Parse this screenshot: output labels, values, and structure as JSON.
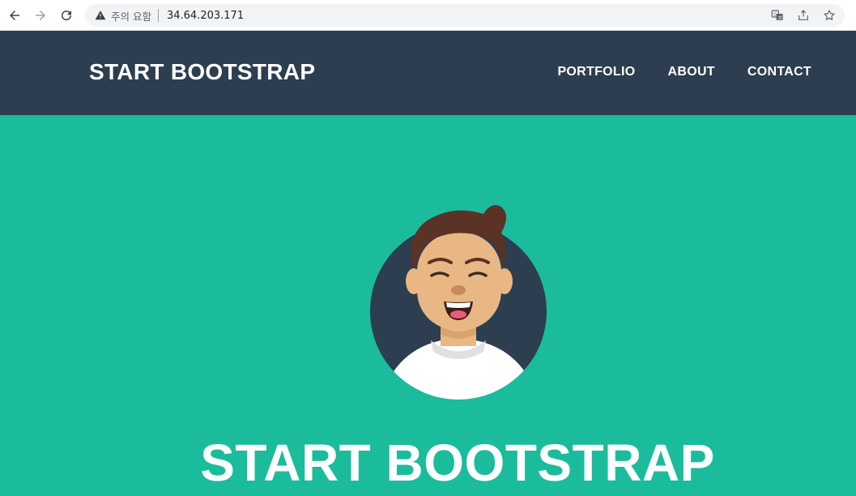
{
  "browser": {
    "security_warning": "주의 요함",
    "url": "34.64.203.171",
    "icons": [
      "back-arrow-icon",
      "forward-arrow-icon",
      "reload-icon",
      "warning-triangle-icon",
      "translate-icon",
      "share-icon",
      "star-icon"
    ]
  },
  "navbar": {
    "brand": "START BOOTSTRAP",
    "items": [
      {
        "label": "PORTFOLIO"
      },
      {
        "label": "ABOUT"
      },
      {
        "label": "CONTACT"
      }
    ]
  },
  "masthead": {
    "title": "START BOOTSTRAP",
    "avatar_icon": "avatar-illustration"
  },
  "colors": {
    "navbar_bg": "#2c3e50",
    "masthead_bg": "#1abc9c",
    "text": "#ffffff"
  }
}
